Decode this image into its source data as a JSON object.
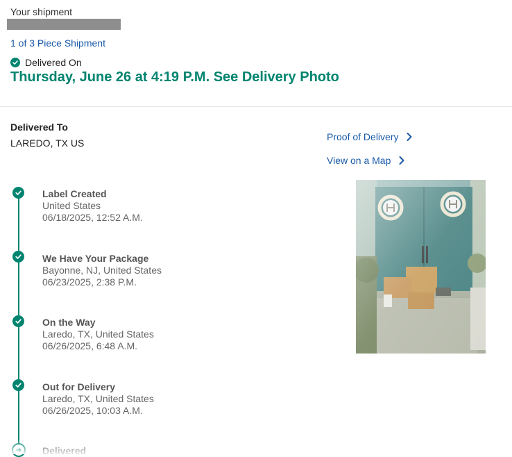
{
  "header": {
    "title": "Your shipment",
    "piece_link": "1 of 3 Piece Shipment",
    "status_label": "Delivered On",
    "headline": "Thursday, June 26 at 4:19 P.M. See Delivery Photo"
  },
  "delivered_to": {
    "label": "Delivered To",
    "value": "LAREDO, TX US"
  },
  "links": {
    "proof_of_delivery": "Proof of Delivery",
    "view_on_map": "View on a Map"
  },
  "timeline": [
    {
      "name": "Label Created",
      "location": "United States",
      "datetime": "06/18/2025, 12:52 A.M."
    },
    {
      "name": "We Have Your Package",
      "location": "Bayonne, NJ, United States",
      "datetime": "06/23/2025, 2:38 P.M."
    },
    {
      "name": "On the Way",
      "location": "Laredo, TX, United States",
      "datetime": "06/26/2025, 6:48 A.M."
    },
    {
      "name": "Out for Delivery",
      "location": "Laredo, TX, United States",
      "datetime": "06/26/2025, 10:03 A.M."
    },
    {
      "name": "Delivered"
    }
  ],
  "colors": {
    "accent": "#00846f",
    "link": "#1a5aa8"
  },
  "icons": {
    "status": "check-circle-icon",
    "link_arrow": "chevron-right-icon",
    "current_step": "arrow-right-circle-icon"
  }
}
